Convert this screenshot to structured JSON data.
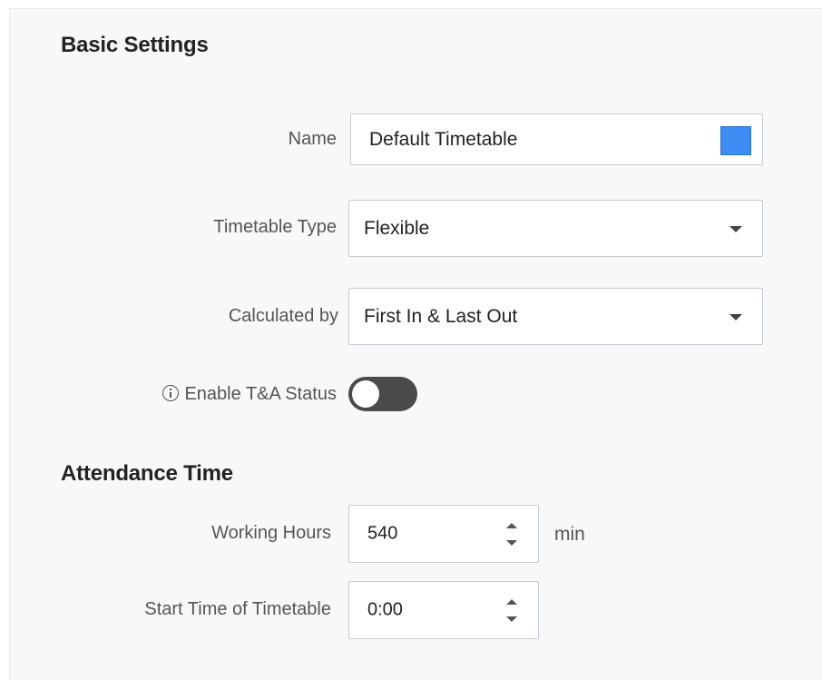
{
  "basic_settings": {
    "title": "Basic Settings",
    "name": {
      "label": "Name",
      "value": "Default Timetable",
      "color": "#3c8cf4"
    },
    "timetable_type": {
      "label": "Timetable Type",
      "value": "Flexible"
    },
    "calculated_by": {
      "label": "Calculated by",
      "value": "First In & Last Out"
    },
    "enable_ta_status": {
      "label": "Enable T&A Status",
      "enabled": false,
      "icon": "info-icon"
    }
  },
  "attendance_time": {
    "title": "Attendance Time",
    "working_hours": {
      "label": "Working Hours",
      "value": "540",
      "unit": "min"
    },
    "start_time": {
      "label": "Start Time of Timetable",
      "value": "0:00"
    }
  }
}
